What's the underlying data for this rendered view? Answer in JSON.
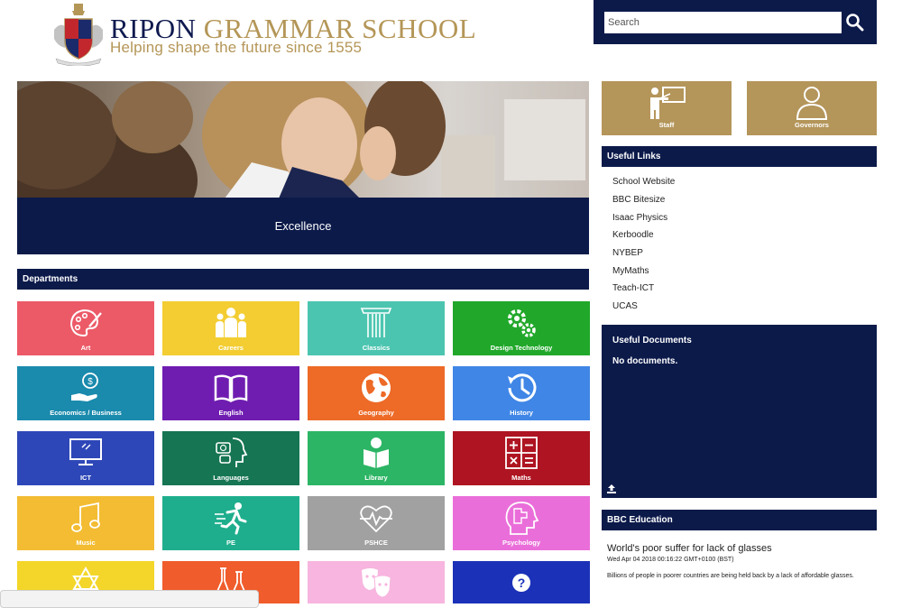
{
  "header": {
    "title_part1": "RIPON",
    "title_part2": "GRAMMAR SCHOOL",
    "tagline": "Helping shape the future since 1555"
  },
  "search": {
    "placeholder": "Search"
  },
  "hero": {
    "caption": "Excellence"
  },
  "departments": {
    "heading": "Departments",
    "tiles": [
      {
        "label": "Art",
        "color": "#ec5a67",
        "icon": "palette-icon"
      },
      {
        "label": "Careers",
        "color": "#f3cd32",
        "icon": "people-icon"
      },
      {
        "label": "Classics",
        "color": "#4cc5b0",
        "icon": "column-icon"
      },
      {
        "label": "Design Technology",
        "color": "#21a82a",
        "icon": "gears-icon"
      },
      {
        "label": "Economics / Business",
        "color": "#1a8aad",
        "icon": "money-hand-icon"
      },
      {
        "label": "English",
        "color": "#6f1db1",
        "icon": "book-icon"
      },
      {
        "label": "Geography",
        "color": "#ed6a27",
        "icon": "globe-icon"
      },
      {
        "label": "History",
        "color": "#3f86e6",
        "icon": "history-icon"
      },
      {
        "label": "ICT",
        "color": "#2e47b8",
        "icon": "monitor-icon"
      },
      {
        "label": "Languages",
        "color": "#167553",
        "icon": "languages-icon"
      },
      {
        "label": "Library",
        "color": "#2cb564",
        "icon": "reader-icon"
      },
      {
        "label": "Maths",
        "color": "#ae1421",
        "icon": "calculator-icon"
      },
      {
        "label": "Music",
        "color": "#f3bc32",
        "icon": "music-note-icon"
      },
      {
        "label": "PE",
        "color": "#1fae8d",
        "icon": "runner-icon"
      },
      {
        "label": "PSHCE",
        "color": "#a1a1a1",
        "icon": "heartbeat-icon"
      },
      {
        "label": "Psychology",
        "color": "#ea6ed9",
        "icon": "brain-head-icon"
      },
      {
        "label": "",
        "color": "#f3d629",
        "icon": "star-icon"
      },
      {
        "label": "",
        "color": "#f05c2c",
        "icon": "flask-icon"
      },
      {
        "label": "",
        "color": "#f7b5df",
        "icon": "theatre-masks-icon"
      },
      {
        "label": "",
        "color": "#1b32b8",
        "icon": "question-icon"
      }
    ]
  },
  "quick_links": [
    {
      "label": "Staff",
      "icon": "teacher-board-icon"
    },
    {
      "label": "Governors",
      "icon": "person-icon"
    }
  ],
  "useful_links": {
    "heading": "Useful Links",
    "items": [
      "School Website",
      "BBC Bitesize",
      "Isaac Physics",
      "Kerboodle",
      "NYBEP",
      "MyMaths",
      "Teach-ICT",
      "UCAS"
    ]
  },
  "useful_documents": {
    "heading": "Useful Documents",
    "empty_text": "No documents."
  },
  "bbc": {
    "heading": "BBC Education",
    "news_title": "World's poor suffer for lack of glasses",
    "news_date": "Wed Apr 04 2018 00:16:22 GMT+0100 (BST)",
    "news_body": "Billions of people in poorer countries are being held back by a lack of affordable glasses."
  },
  "colors": {
    "navy": "#0c1a4a",
    "gold": "#b4955a"
  }
}
